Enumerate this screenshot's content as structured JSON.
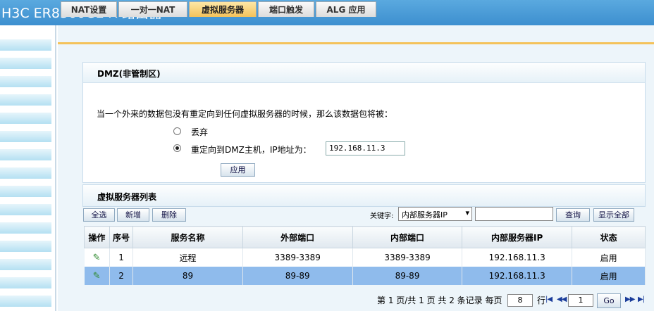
{
  "header": {
    "title": "H3C ER8300G2-X 路由器"
  },
  "tabs": [
    {
      "label": "NAT设置"
    },
    {
      "label": "一对一NAT"
    },
    {
      "label": "虚拟服务器"
    },
    {
      "label": "端口触发"
    },
    {
      "label": "ALG 应用"
    }
  ],
  "dmz": {
    "title": "DMZ(非管制区)",
    "description": "当一个外来的数据包没有重定向到任何虚拟服务器的时候，那么该数据包将被：",
    "option_drop": "丢弃",
    "option_redirect": "重定向到DMZ主机，IP地址为：",
    "ip": "192.168.11.3",
    "apply_label": "应用",
    "selected": "redirect"
  },
  "list": {
    "title": "虚拟服务器列表",
    "select_all": "全选",
    "add": "新增",
    "delete": "删除",
    "keyword_label": "关键字:",
    "keyword_field": "内部服务器IP",
    "keyword_value": "",
    "query": "查询",
    "show_all": "显示全部",
    "columns": [
      "操作",
      "序号",
      "服务名称",
      "外部端口",
      "内部端口",
      "内部服务器IP",
      "状态"
    ],
    "rows": [
      {
        "index": "1",
        "name": "远程",
        "ext_port": "3389-3389",
        "int_port": "3389-3389",
        "ip": "192.168.11.3",
        "status": "启用"
      },
      {
        "index": "2",
        "name": "89",
        "ext_port": "89-89",
        "int_port": "89-89",
        "ip": "192.168.11.3",
        "status": "启用"
      }
    ]
  },
  "pager": {
    "summary": "第 1 页/共 1 页 共 2 条记录 每页",
    "per_page": "8",
    "rows_label": "行",
    "page": "1",
    "go": "Go",
    "first": "|◀",
    "prev": "◀◀",
    "next": "▶▶",
    "last": "▶|"
  }
}
